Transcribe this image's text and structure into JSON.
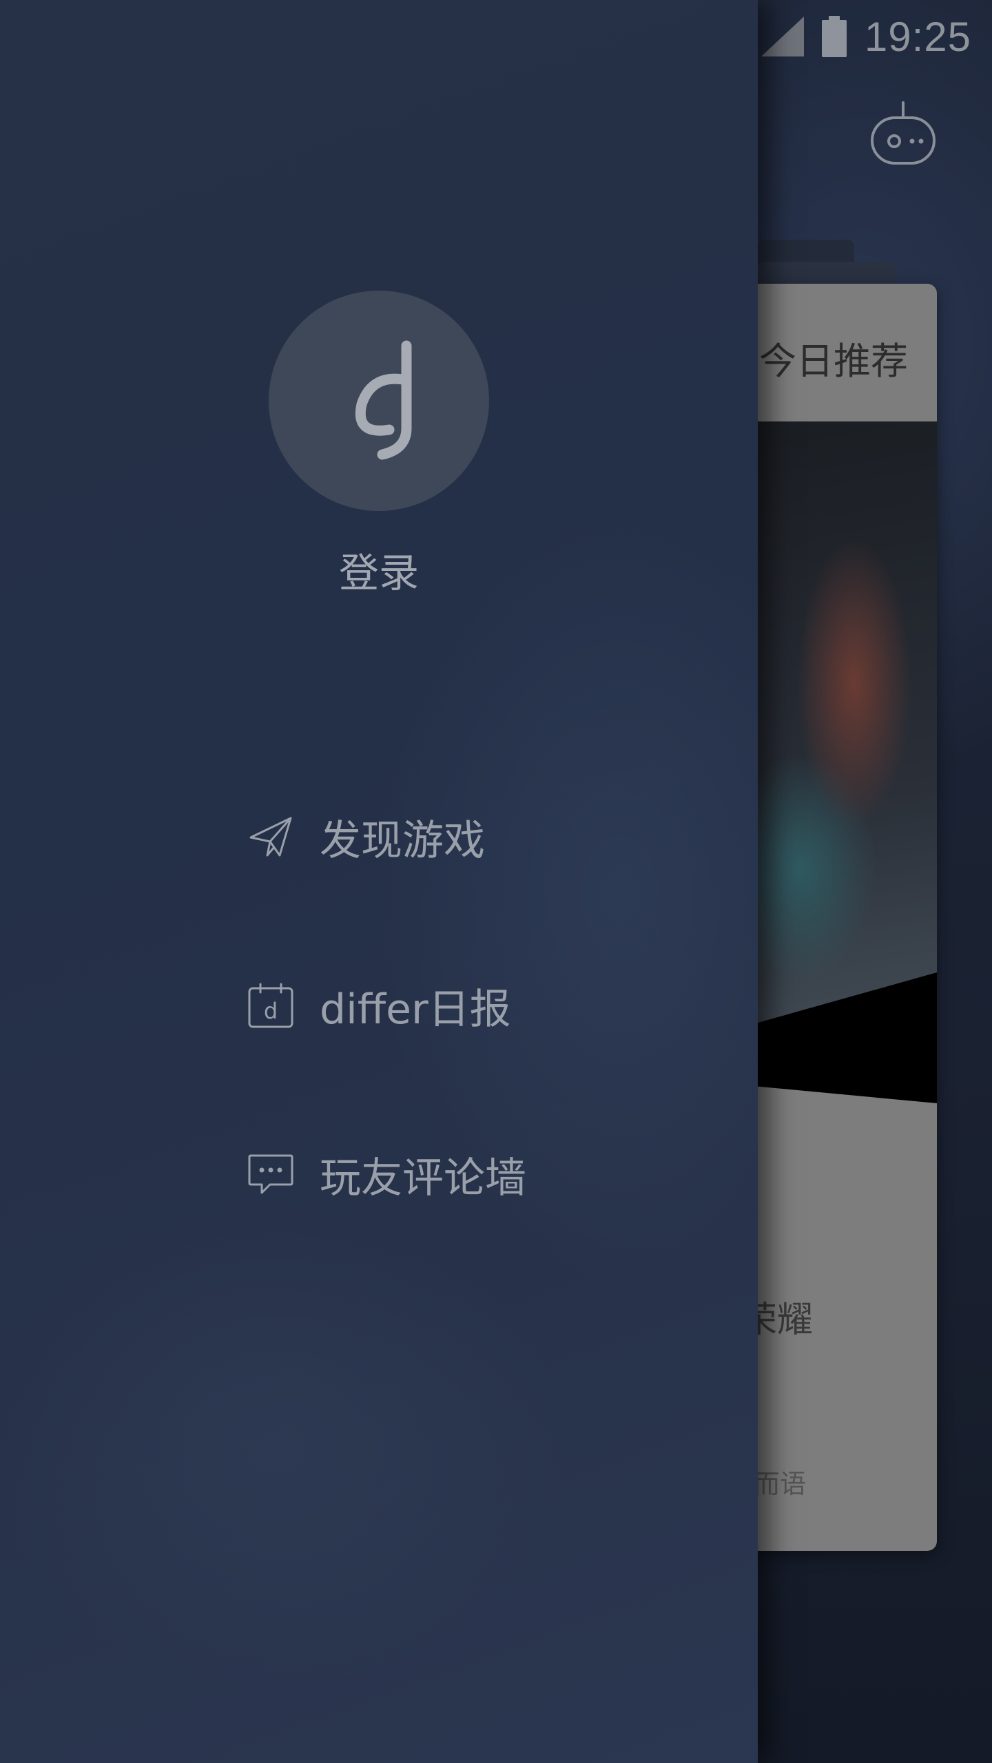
{
  "status_bar": {
    "time": "19:25",
    "icons": [
      "signal-icon",
      "battery-icon"
    ]
  },
  "background_app": {
    "bot_icon": "robot-icon",
    "card": {
      "heading": "今日推荐",
      "title_fragment": "荣耀",
      "subtitle_fragment": "而语"
    }
  },
  "drawer": {
    "avatar_icon": "differ-logo-icon",
    "login_label": "登录",
    "menu": [
      {
        "icon": "paper-plane-icon",
        "label": "发现游戏"
      },
      {
        "icon": "calendar-d-icon",
        "label": "differ日报"
      },
      {
        "icon": "chat-bubble-icon",
        "label": "玩友评论墙"
      }
    ]
  },
  "colors": {
    "drawer_bg": "#263046",
    "text_muted": "#9aa0aa",
    "avatar_bg": "#3f4859"
  }
}
